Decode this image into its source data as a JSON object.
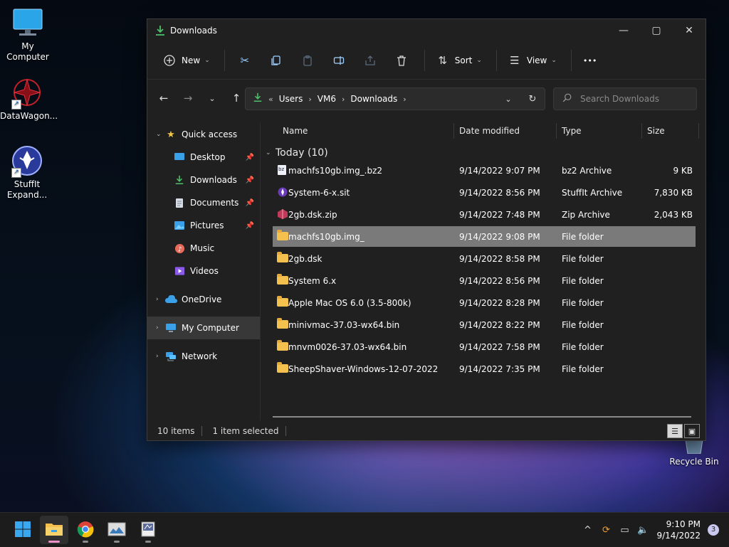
{
  "desktop": {
    "icons": [
      {
        "label": "My Computer"
      },
      {
        "label": "DataWagon..."
      },
      {
        "label": "StuffIt Expand..."
      },
      {
        "label": "Recycle Bin"
      }
    ]
  },
  "window": {
    "title": "Downloads",
    "controls": {
      "minimize": "—",
      "maximize": "▢",
      "close": "✕"
    }
  },
  "toolbar": {
    "new_label": "New",
    "sort_label": "Sort",
    "view_label": "View",
    "more_label": "•••"
  },
  "address": {
    "crumbs": [
      "Users",
      "VM6",
      "Downloads"
    ]
  },
  "search": {
    "placeholder": "Search Downloads"
  },
  "sidebar": {
    "items": [
      {
        "label": "Quick access"
      },
      {
        "label": "Desktop"
      },
      {
        "label": "Downloads"
      },
      {
        "label": "Documents"
      },
      {
        "label": "Pictures"
      },
      {
        "label": "Music"
      },
      {
        "label": "Videos"
      },
      {
        "label": "OneDrive"
      },
      {
        "label": "My Computer"
      },
      {
        "label": "Network"
      }
    ]
  },
  "filelist": {
    "columns": {
      "name": "Name",
      "date": "Date modified",
      "type": "Type",
      "size": "Size"
    },
    "group": "Today (10)",
    "rows": [
      {
        "name": "machfs10gb.img_.bz2",
        "date": "9/14/2022 9:07 PM",
        "type": "bz2 Archive",
        "size": "9 KB"
      },
      {
        "name": "System-6-x.sit",
        "date": "9/14/2022 8:56 PM",
        "type": "StuffIt Archive",
        "size": "7,830 KB"
      },
      {
        "name": "2gb.dsk.zip",
        "date": "9/14/2022 7:48 PM",
        "type": "Zip Archive",
        "size": "2,043 KB"
      },
      {
        "name": "machfs10gb.img_",
        "date": "9/14/2022 9:08 PM",
        "type": "File folder",
        "size": ""
      },
      {
        "name": "2gb.dsk",
        "date": "9/14/2022 8:58 PM",
        "type": "File folder",
        "size": ""
      },
      {
        "name": "System 6.x",
        "date": "9/14/2022 8:56 PM",
        "type": "File folder",
        "size": ""
      },
      {
        "name": "Apple Mac OS 6.0 (3.5-800k)",
        "date": "9/14/2022 8:28 PM",
        "type": "File folder",
        "size": ""
      },
      {
        "name": "minivmac-37.03-wx64.bin",
        "date": "9/14/2022 8:22 PM",
        "type": "File folder",
        "size": ""
      },
      {
        "name": "mnvm0026-37.03-wx64.bin",
        "date": "9/14/2022 7:58 PM",
        "type": "File folder",
        "size": ""
      },
      {
        "name": "SheepShaver-Windows-12-07-2022",
        "date": "9/14/2022 7:35 PM",
        "type": "File folder",
        "size": ""
      }
    ]
  },
  "status": {
    "count": "10 items",
    "selected": "1 item selected"
  },
  "taskbar": {
    "time": "9:10 PM",
    "date": "9/14/2022",
    "notifications": "3"
  },
  "colors": {
    "accent": "#4cc26a",
    "folder": "#f4c14f",
    "selection": "#7a7a7a"
  }
}
